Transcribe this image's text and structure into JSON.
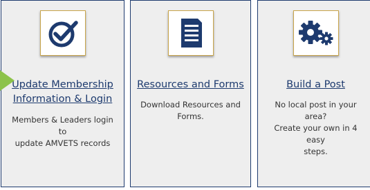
{
  "colors": {
    "navy": "#1d3a6e",
    "card_bg": "#eeeeee",
    "icon_border": "#c9a54a",
    "pointer_green": "#8dc34a"
  },
  "cards": [
    {
      "icon": "checkmark-circle-icon",
      "title_line1": "Update Membership",
      "title_line2": "Information & Login",
      "desc_line1": "Members & Leaders login to",
      "desc_line2": "update AMVETS records"
    },
    {
      "icon": "document-icon",
      "title": "Resources and Forms",
      "desc_line1": "Download Resources and",
      "desc_line2": "Forms."
    },
    {
      "icon": "gears-icon",
      "title": "Build a Post",
      "desc_line1": "No local post in your area?",
      "desc_line2": "Create your own in 4 easy",
      "desc_line3": "steps."
    }
  ]
}
